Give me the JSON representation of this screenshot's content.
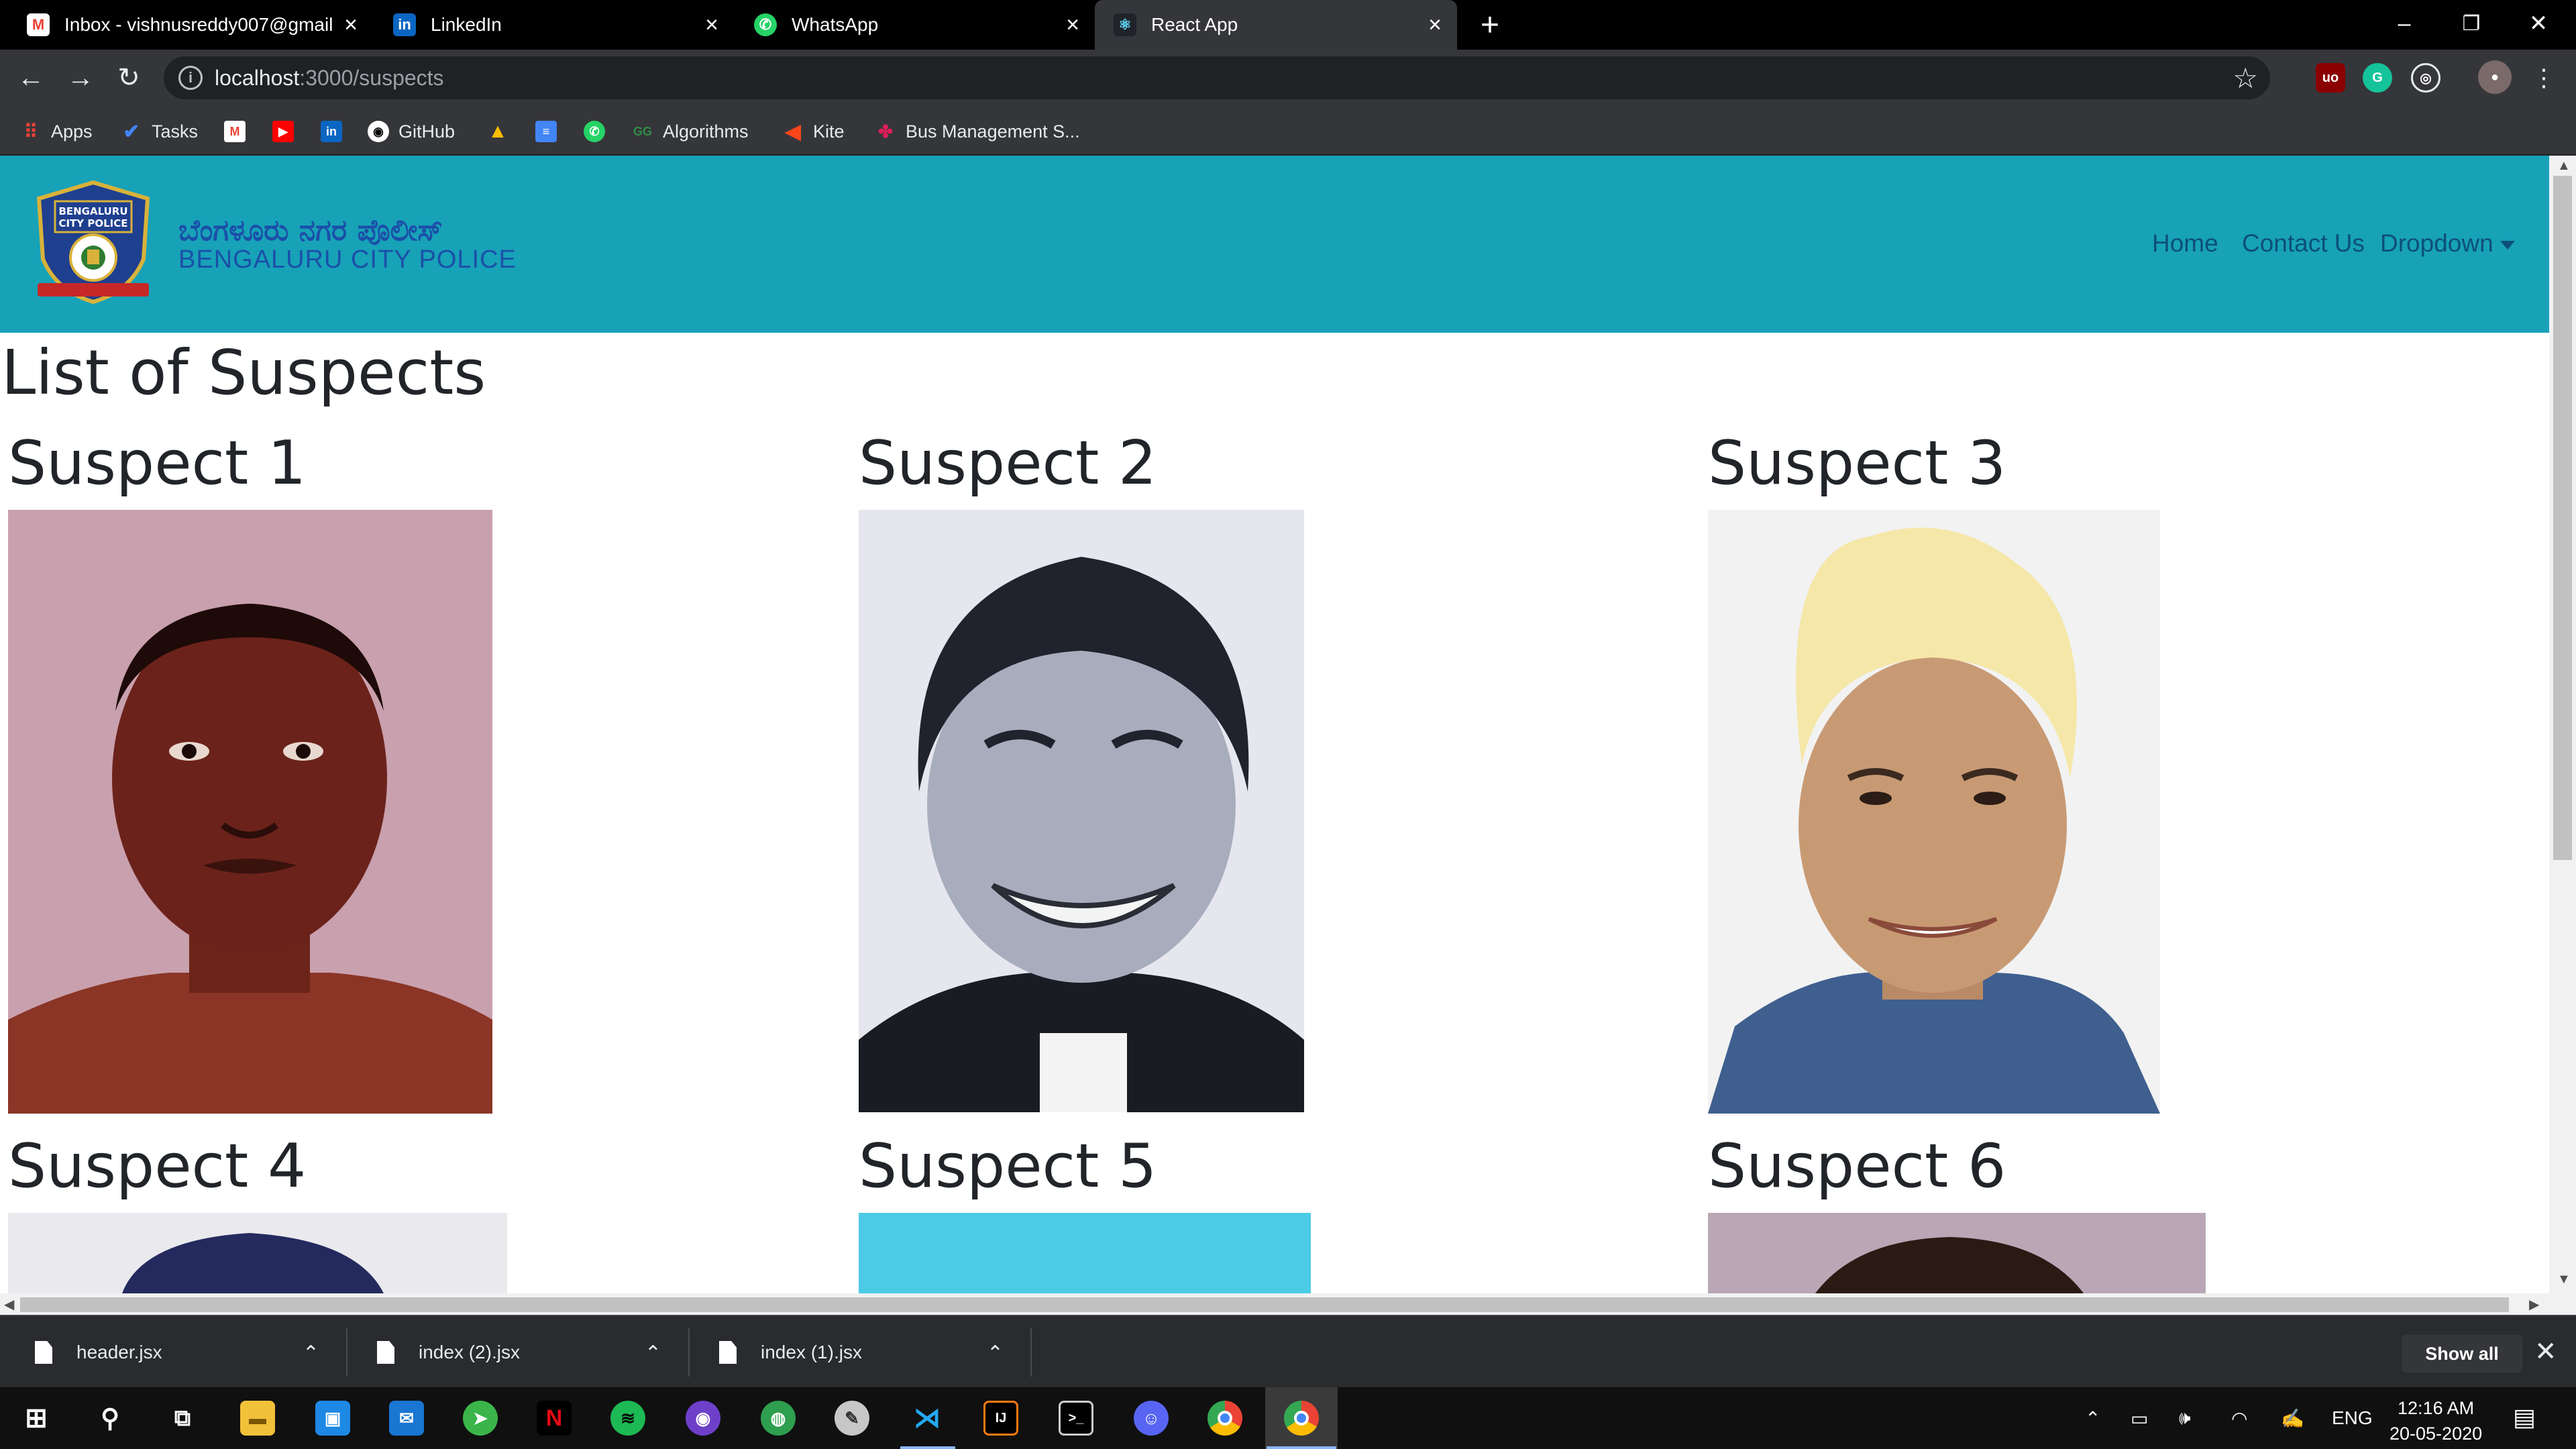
{
  "browser": {
    "tabs": [
      {
        "title": "Inbox - vishnusreddy007@gmail.",
        "favicon": "gmail-icon",
        "color": "#ea4335",
        "active": false
      },
      {
        "title": "LinkedIn",
        "favicon": "linkedin-icon",
        "color": "#0a66c2",
        "active": false
      },
      {
        "title": "WhatsApp",
        "favicon": "whatsapp-icon",
        "color": "#25d366",
        "active": false
      },
      {
        "title": "React App",
        "favicon": "react-icon",
        "color": "#61dafb",
        "active": true
      }
    ],
    "url_host": "localhost",
    "url_path": ":3000/suspects",
    "bookmarks": [
      {
        "label": "Apps",
        "icon": "apps-grid-icon"
      },
      {
        "label": "Tasks",
        "icon": "tasks-check-icon"
      },
      {
        "label": "",
        "icon": "gmail-icon"
      },
      {
        "label": "",
        "icon": "youtube-icon"
      },
      {
        "label": "",
        "icon": "linkedin-icon"
      },
      {
        "label": "GitHub",
        "icon": "github-icon"
      },
      {
        "label": "",
        "icon": "google-drive-icon"
      },
      {
        "label": "",
        "icon": "google-docs-icon"
      },
      {
        "label": "",
        "icon": "whatsapp-icon"
      },
      {
        "label": "Algorithms",
        "icon": "geeksforgeeks-icon"
      },
      {
        "label": "Kite",
        "icon": "kite-icon"
      },
      {
        "label": "Bus Management S...",
        "icon": "slack-icon"
      }
    ]
  },
  "site": {
    "brand_kannada": "ಬೆಂಗಳೂರು ನಗರ ಪೊಲೀಸ್",
    "brand_english": "BENGALURU CITY POLICE",
    "logo_text_top": "BENGALURU",
    "logo_text_bottom": "CITY POLICE",
    "nav": {
      "home": "Home",
      "contact": "Contact Us",
      "dropdown": "Dropdown"
    },
    "page_heading": "List of Suspects",
    "suspects": [
      {
        "name": "Suspect 1",
        "photo": "mugshot-photo-1"
      },
      {
        "name": "Suspect 2",
        "photo": "mugshot-photo-2"
      },
      {
        "name": "Suspect 3",
        "photo": "mugshot-photo-3"
      },
      {
        "name": "Suspect 4",
        "photo": "mugshot-photo-4"
      },
      {
        "name": "Suspect 5",
        "photo": "mugshot-photo-5"
      },
      {
        "name": "Suspect 6",
        "photo": "mugshot-photo-6"
      }
    ],
    "navbar_color": "#17a2b8"
  },
  "downloads": {
    "items": [
      "header.jsx",
      "index (2).jsx",
      "index (1).jsx"
    ],
    "show_all": "Show all"
  },
  "taskbar": {
    "language": "ENG",
    "time": "12:16 AM",
    "date": "20-05-2020"
  }
}
